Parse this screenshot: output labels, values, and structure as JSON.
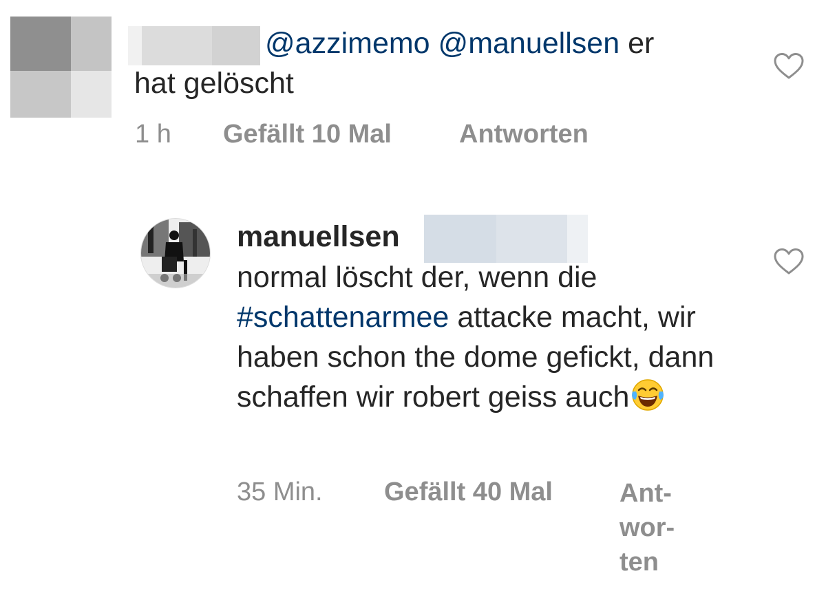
{
  "comment1": {
    "mentions": [
      "@azzimemo",
      "@manuellsen"
    ],
    "text_after_mentions": "er",
    "text_line2": "hat gelöscht",
    "time": "1 h",
    "likes": "Gefällt 10 Mal",
    "reply": "Antworten"
  },
  "comment2": {
    "username": "manuellsen",
    "text_before_hashtag": "normal löscht der, wenn die",
    "hashtag": "#schattenarmee",
    "text_after_hashtag": "attacke macht, wir haben schon the dome gefickt, dann schaffen wir robert geiss auch",
    "time": "35 Min.",
    "likes": "Gefällt 40 Mal",
    "reply_lines": [
      "Ant-",
      "wor-",
      "ten"
    ]
  },
  "icons": {
    "like": "heart-outline-icon",
    "emoji": "face-with-tears-of-joy-icon"
  },
  "colors": {
    "text": "#262626",
    "link": "#00376b",
    "meta": "#8e8e8e"
  }
}
